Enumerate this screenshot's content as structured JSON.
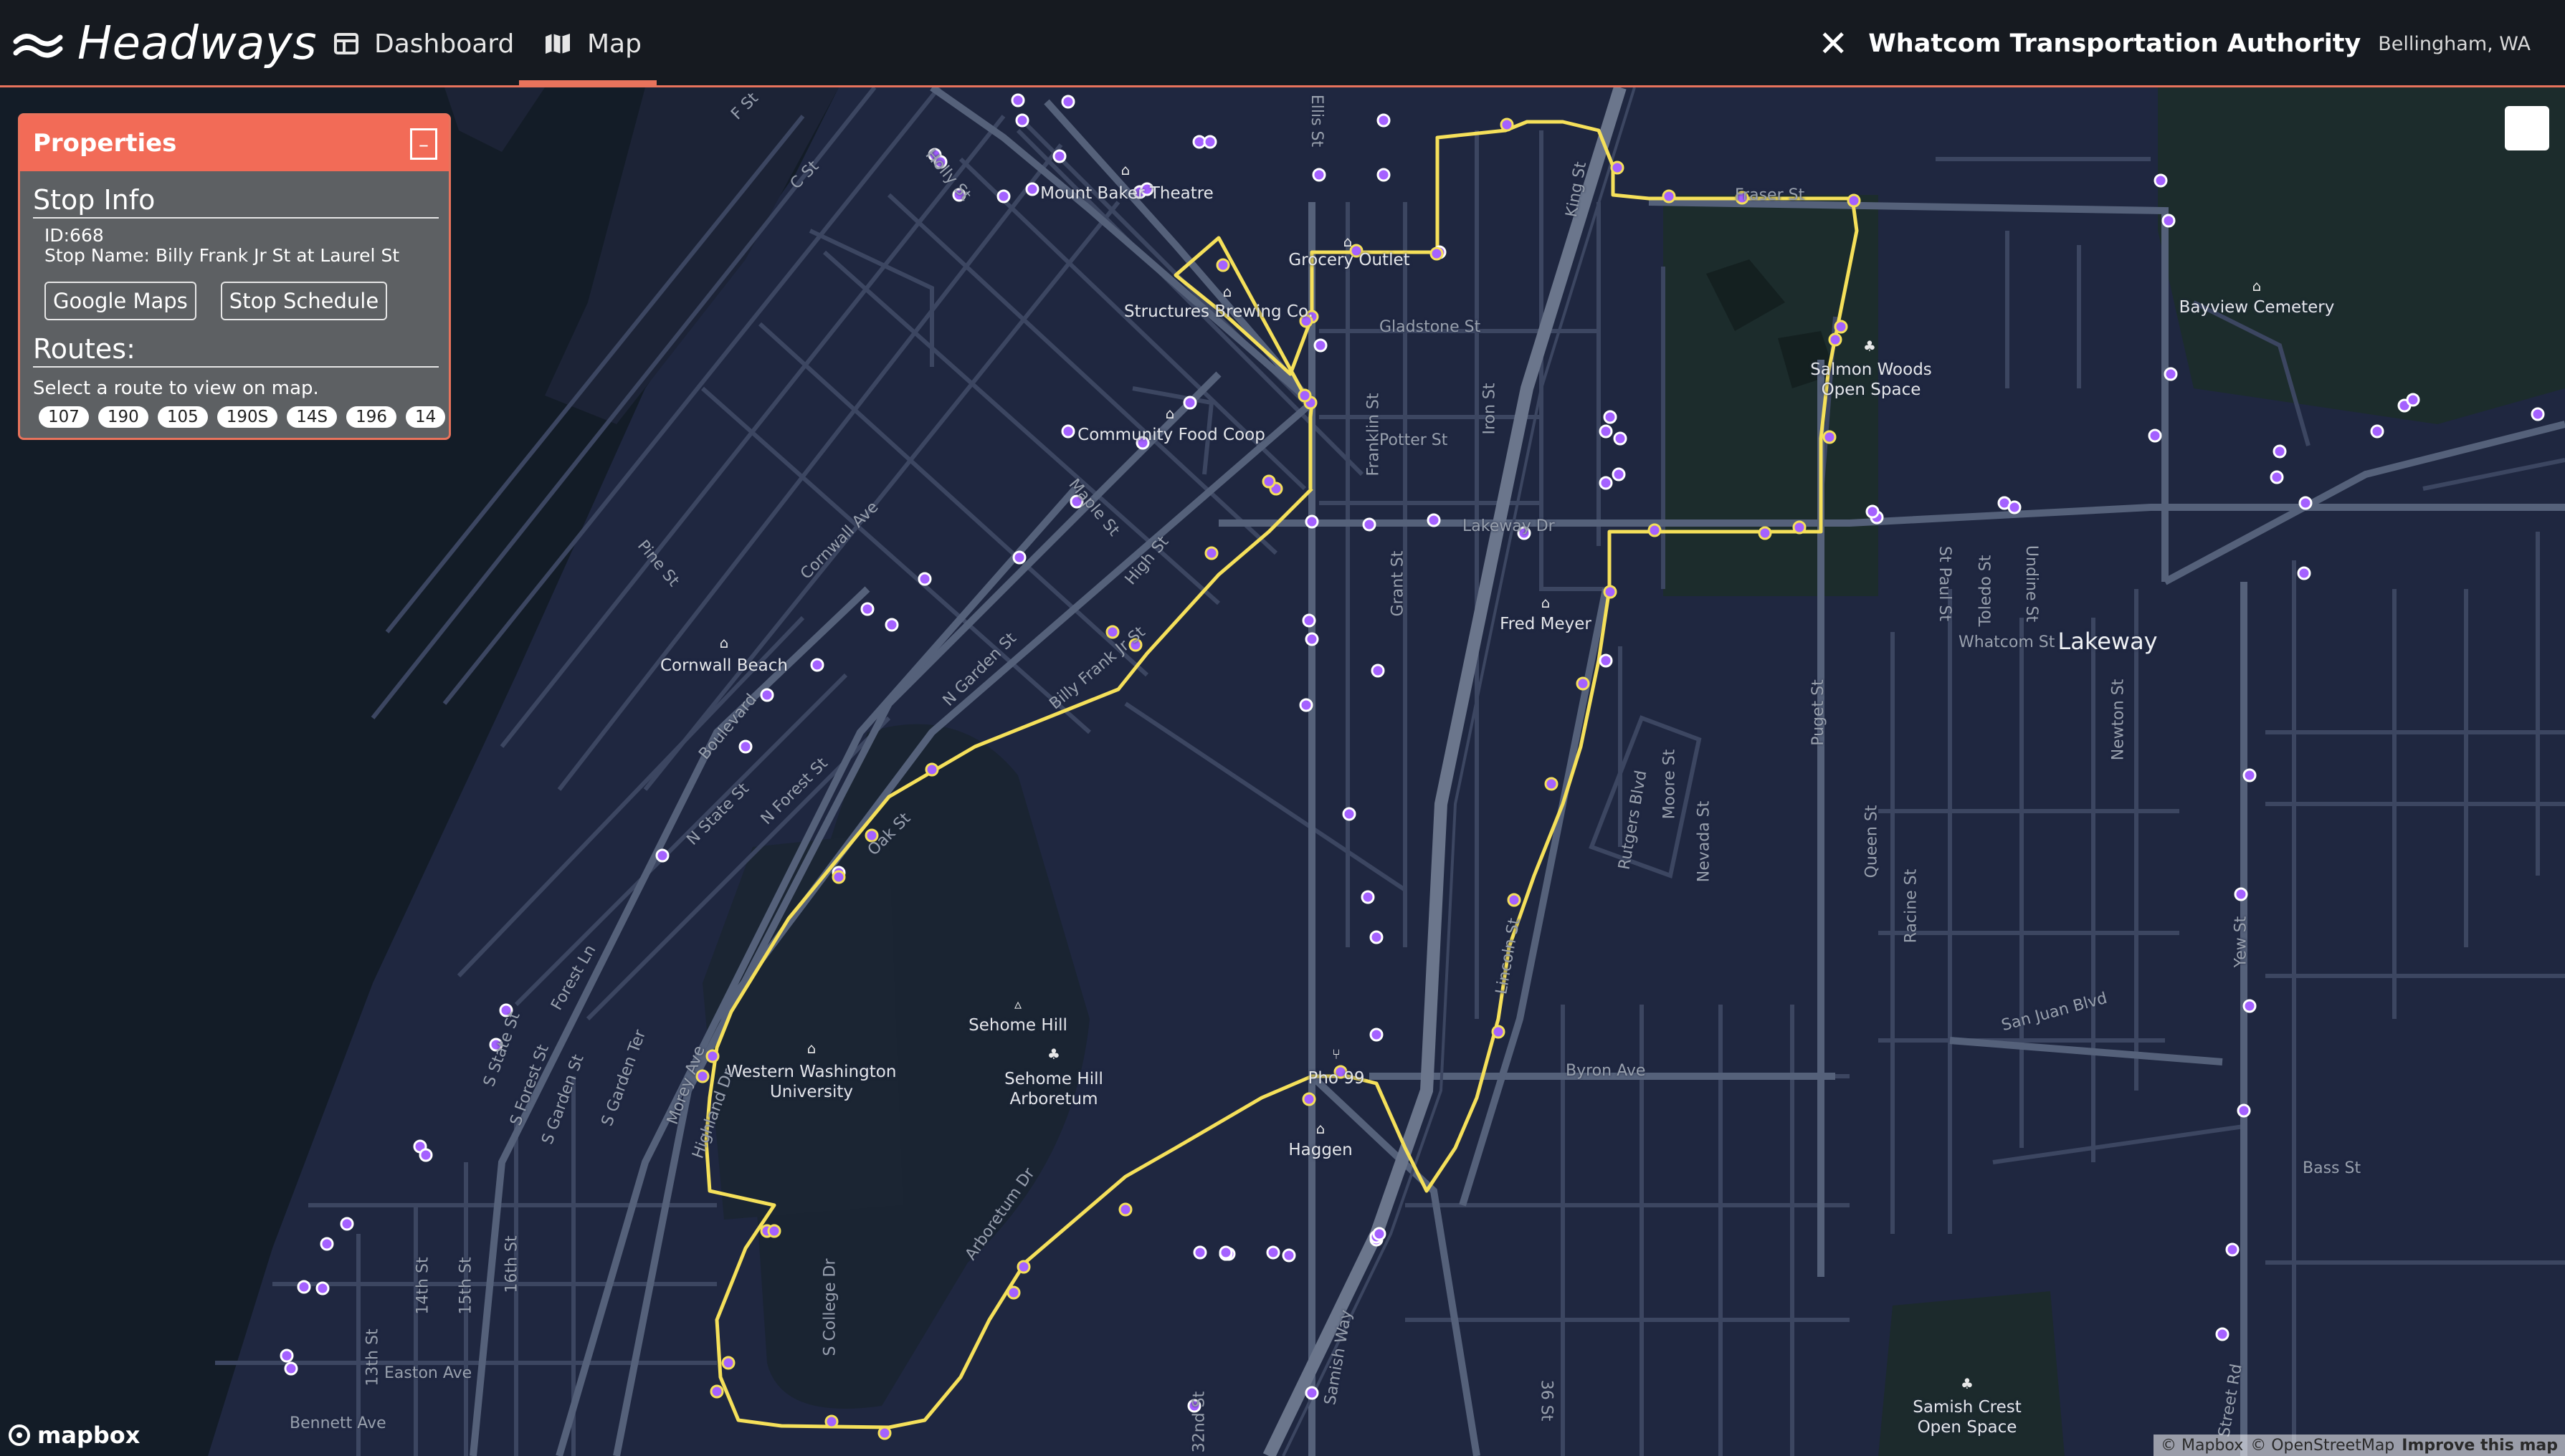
{
  "app": {
    "name": "Headways",
    "nav": [
      {
        "label": "Dashboard",
        "icon": "dashboard-icon"
      },
      {
        "label": "Map",
        "icon": "map-icon",
        "active": true
      }
    ],
    "agency": {
      "name": "Whatcom Transportation Authority",
      "city": "Bellingham, WA",
      "close_icon": "close-icon"
    }
  },
  "panel": {
    "title": "Properties",
    "toggle_label": "–",
    "stop_info_title": "Stop Info",
    "stop_id_text": "ID:668",
    "stop_name_text": "Stop Name: Billy Frank Jr St at Laurel St",
    "google_maps_label": "Google Maps",
    "stop_schedule_label": "Stop Schedule",
    "routes_title": "Routes:",
    "routes_hint": "Select a route to view on map.",
    "routes": [
      "107",
      "190",
      "105",
      "190S",
      "14S",
      "196",
      "14"
    ]
  },
  "map": {
    "route_color": "#f5e05a",
    "stop_color": "#a461ff",
    "labels": {
      "mount_baker": "Mount Baker Theatre",
      "grocery_outlet": "Grocery Outlet",
      "structures": "Structures Brewing Co.",
      "community_food": "Community Food Coop",
      "cornwall_beach": "Cornwall Beach",
      "wwu": "Western Washington\nUniversity",
      "sehome_hill": "Sehome Hill",
      "arboretum": "Sehome Hill\nArboretum",
      "pho": "Pho 99",
      "haggen": "Haggen",
      "fred_meyer": "Fred Meyer",
      "salmon_woods": "Salmon Woods\nOpen Space",
      "bayview": "Bayview Cemetery",
      "lakeway": "Lakeway",
      "samish": "Samish Crest\nOpen Space"
    },
    "streets": {
      "f": "F St",
      "c": "C St",
      "holly": "Holly St",
      "ellis": "Ellis St",
      "king": "King St",
      "fraser": "Fraser St",
      "gladstone": "Gladstone St",
      "potter": "Potter St",
      "iron": "Iron St",
      "franklin": "Franklin St",
      "lakeway_dr": "Lakeway Dr",
      "maple": "Maple St",
      "high": "High St",
      "cornwall_ave": "Cornwall Ave",
      "pine": "Pine St",
      "n_garden": "N Garden St",
      "billy_frank": "Billy Frank Jr St",
      "boulevard": "Boulevard",
      "n_state": "N State St",
      "n_forest": "N Forest St",
      "oak": "Oak St",
      "grant": "Grant St",
      "rutgers": "Rutgers Blvd",
      "moore": "Moore St",
      "nevada": "Nevada St",
      "puget": "Puget St",
      "st_paul": "St Paul St",
      "toledo": "Toledo St",
      "undine": "Undine St",
      "whatcom": "Whatcom St",
      "newton": "Newton St",
      "queen": "Queen St",
      "racine": "Racine St",
      "san_juan": "San Juan Blvd",
      "byron": "Byron Ave",
      "bass": "Bass St",
      "yew": "Yew St",
      "forest_ln": "Forest Ln",
      "s_state": "S State St",
      "s_forest": "S Forest St",
      "s_garden": "S Garden St",
      "s_garden_ter": "S Garden Ter",
      "morey": "Morey Ave",
      "highland": "Highland Dr",
      "arboretum_dr": "Arboretum Dr",
      "s_college": "S College Dr",
      "lincoln": "Lincoln St",
      "samish_way": "Samish Way",
      "th14": "14th St",
      "th15": "15th St",
      "th16": "16th St",
      "th13": "13th St",
      "easton": "Easton Ave",
      "bennett": "Bennett Ave",
      "st32": "32nd St",
      "st36": "36 St",
      "street_rd": "Street Rd"
    }
  },
  "attribution": {
    "mapbox": "© Mapbox",
    "osm": "© OpenStreetMap",
    "improve": "Improve this map"
  },
  "mapbox_logo": "mapbox"
}
